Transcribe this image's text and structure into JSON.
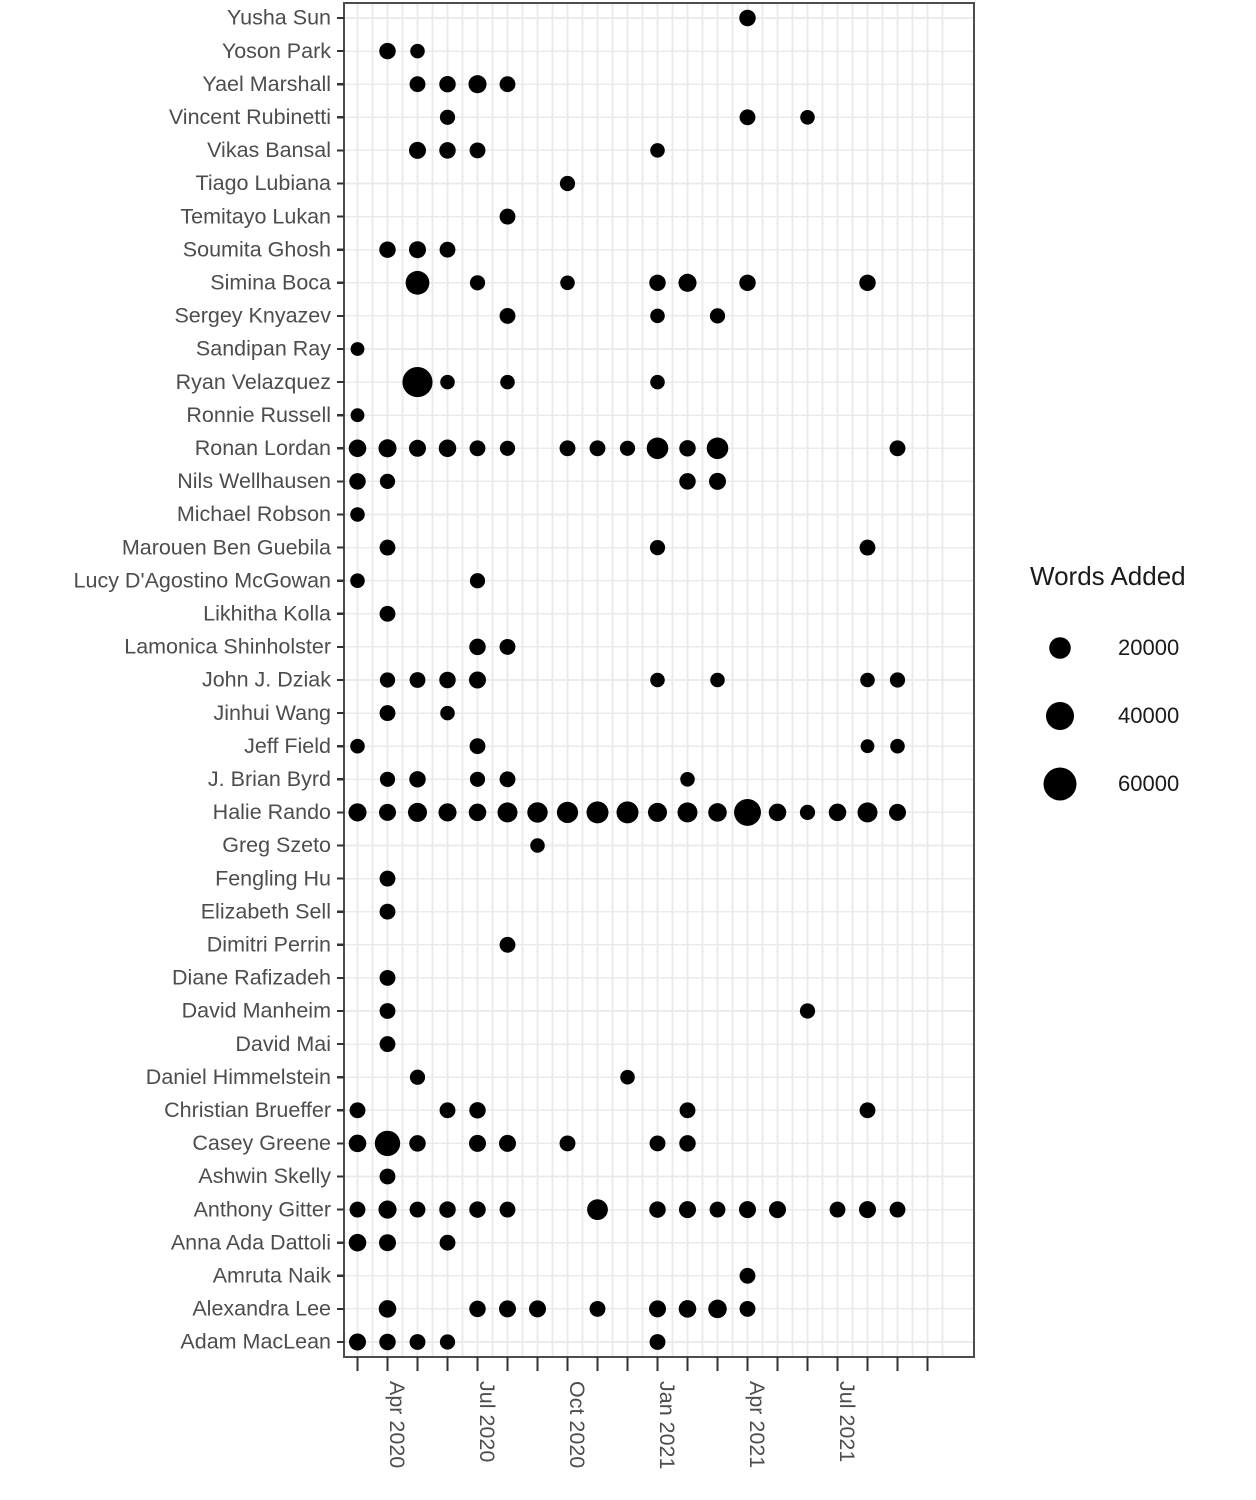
{
  "legend": {
    "title": "Words Added",
    "keys": [
      {
        "label": "20000",
        "value": 20000
      },
      {
        "label": "40000",
        "value": 40000
      },
      {
        "label": "60000",
        "value": 60000
      }
    ]
  },
  "axes": {
    "x_tick_labels": [
      "Apr 2020",
      "Jul 2020",
      "Oct 2020",
      "Jan 2021",
      "Apr 2021",
      "Jul 2021"
    ],
    "x_label": "",
    "y_label": ""
  },
  "chart_data": {
    "type": "scatter",
    "title": "",
    "xlabel": "",
    "ylabel": "",
    "size_legend_title": "Words Added",
    "size_legend_breaks": [
      20000,
      40000,
      60000
    ],
    "grid": true,
    "legend_position": "right",
    "x_axis_type": "date-month",
    "x_months": [
      "2020-03",
      "2020-04",
      "2020-05",
      "2020-06",
      "2020-07",
      "2020-08",
      "2020-09",
      "2020-10",
      "2020-11",
      "2020-12",
      "2021-01",
      "2021-02",
      "2021-03",
      "2021-04",
      "2021-05",
      "2021-06",
      "2021-07",
      "2021-08",
      "2021-09",
      "2021-10"
    ],
    "x_tick_labels": [
      "Apr 2020",
      "Jul 2020",
      "Oct 2020",
      "Jan 2021",
      "Apr 2021",
      "Jul 2021"
    ],
    "x_tick_months": [
      "2020-04",
      "2020-07",
      "2020-10",
      "2021-01",
      "2021-04",
      "2021-07"
    ],
    "categories": [
      "Yusha Sun",
      "Yoson Park",
      "Yael Marshall",
      "Vincent Rubinetti",
      "Vikas Bansal",
      "Tiago Lubiana",
      "Temitayo Lukan",
      "Soumita Ghosh",
      "Simina Boca",
      "Sergey Knyazev",
      "Sandipan Ray",
      "Ryan Velazquez",
      "Ronnie Russell",
      "Ronan Lordan",
      "Nils Wellhausen",
      "Michael Robson",
      "Marouen Ben Guebila",
      "Lucy D'Agostino McGowan",
      "Likhitha Kolla",
      "Lamonica Shinholster",
      "John J. Dziak",
      "Jinhui Wang",
      "Jeff Field",
      "J. Brian Byrd",
      "Halie Rando",
      "Greg Szeto",
      "Fengling Hu",
      "Elizabeth Sell",
      "Dimitri Perrin",
      "Diane Rafizadeh",
      "David Manheim",
      "David Mai",
      "Daniel Himmelstein",
      "Christian Brueffer",
      "Casey Greene",
      "Ashwin Skelly",
      "Anthony Gitter",
      "Anna Ada Dattoli",
      "Amruta Naik",
      "Alexandra Lee",
      "Adam MacLean"
    ],
    "points": [
      {
        "author": "Yusha Sun",
        "month": "2021-04",
        "words": 9000
      },
      {
        "author": "Yoson Park",
        "month": "2020-04",
        "words": 9000
      },
      {
        "author": "Yoson Park",
        "month": "2020-05",
        "words": 6000
      },
      {
        "author": "Yael Marshall",
        "month": "2020-05",
        "words": 8000
      },
      {
        "author": "Yael Marshall",
        "month": "2020-06",
        "words": 9000
      },
      {
        "author": "Yael Marshall",
        "month": "2020-07",
        "words": 12000
      },
      {
        "author": "Yael Marshall",
        "month": "2020-08",
        "words": 8000
      },
      {
        "author": "Vincent Rubinetti",
        "month": "2020-06",
        "words": 7000
      },
      {
        "author": "Vincent Rubinetti",
        "month": "2021-04",
        "words": 8000
      },
      {
        "author": "Vincent Rubinetti",
        "month": "2021-06",
        "words": 6000
      },
      {
        "author": "Vikas Bansal",
        "month": "2020-05",
        "words": 10000
      },
      {
        "author": "Vikas Bansal",
        "month": "2020-06",
        "words": 9000
      },
      {
        "author": "Vikas Bansal",
        "month": "2020-07",
        "words": 8000
      },
      {
        "author": "Vikas Bansal",
        "month": "2021-01",
        "words": 6000
      },
      {
        "author": "Tiago Lubiana",
        "month": "2020-10",
        "words": 7000
      },
      {
        "author": "Temitayo Lukan",
        "month": "2020-08",
        "words": 8000
      },
      {
        "author": "Soumita Ghosh",
        "month": "2020-04",
        "words": 9000
      },
      {
        "author": "Soumita Ghosh",
        "month": "2020-05",
        "words": 10000
      },
      {
        "author": "Soumita Ghosh",
        "month": "2020-06",
        "words": 8000
      },
      {
        "author": "Simina Boca",
        "month": "2020-05",
        "words": 26000
      },
      {
        "author": "Simina Boca",
        "month": "2020-07",
        "words": 7000
      },
      {
        "author": "Simina Boca",
        "month": "2020-10",
        "words": 6000
      },
      {
        "author": "Simina Boca",
        "month": "2021-01",
        "words": 9000
      },
      {
        "author": "Simina Boca",
        "month": "2021-02",
        "words": 12000
      },
      {
        "author": "Simina Boca",
        "month": "2021-04",
        "words": 9000
      },
      {
        "author": "Simina Boca",
        "month": "2021-08",
        "words": 9000
      },
      {
        "author": "Sergey Knyazev",
        "month": "2020-08",
        "words": 8000
      },
      {
        "author": "Sergey Knyazev",
        "month": "2021-01",
        "words": 6000
      },
      {
        "author": "Sergey Knyazev",
        "month": "2021-03",
        "words": 7000
      },
      {
        "author": "Sandipan Ray",
        "month": "2020-03",
        "words": 5000
      },
      {
        "author": "Ryan Velazquez",
        "month": "2020-05",
        "words": 48000
      },
      {
        "author": "Ryan Velazquez",
        "month": "2020-06",
        "words": 6000
      },
      {
        "author": "Ryan Velazquez",
        "month": "2020-08",
        "words": 6000
      },
      {
        "author": "Ryan Velazquez",
        "month": "2021-01",
        "words": 6000
      },
      {
        "author": "Ronnie Russell",
        "month": "2020-03",
        "words": 5000
      },
      {
        "author": "Ronan Lordan",
        "month": "2020-03",
        "words": 11000
      },
      {
        "author": "Ronan Lordan",
        "month": "2020-04",
        "words": 12000
      },
      {
        "author": "Ronan Lordan",
        "month": "2020-05",
        "words": 10000
      },
      {
        "author": "Ronan Lordan",
        "month": "2020-06",
        "words": 11000
      },
      {
        "author": "Ronan Lordan",
        "month": "2020-07",
        "words": 8000
      },
      {
        "author": "Ronan Lordan",
        "month": "2020-08",
        "words": 7000
      },
      {
        "author": "Ronan Lordan",
        "month": "2020-10",
        "words": 8000
      },
      {
        "author": "Ronan Lordan",
        "month": "2020-11",
        "words": 8000
      },
      {
        "author": "Ronan Lordan",
        "month": "2020-12",
        "words": 7000
      },
      {
        "author": "Ronan Lordan",
        "month": "2021-01",
        "words": 20000
      },
      {
        "author": "Ronan Lordan",
        "month": "2021-02",
        "words": 9000
      },
      {
        "author": "Ronan Lordan",
        "month": "2021-03",
        "words": 20000
      },
      {
        "author": "Ronan Lordan",
        "month": "2021-09",
        "words": 8000
      },
      {
        "author": "Nils Wellhausen",
        "month": "2020-03",
        "words": 9000
      },
      {
        "author": "Nils Wellhausen",
        "month": "2020-04",
        "words": 7000
      },
      {
        "author": "Nils Wellhausen",
        "month": "2021-02",
        "words": 9000
      },
      {
        "author": "Nils Wellhausen",
        "month": "2021-03",
        "words": 10000
      },
      {
        "author": "Michael Robson",
        "month": "2020-03",
        "words": 6000
      },
      {
        "author": "Marouen Ben Guebila",
        "month": "2020-04",
        "words": 8000
      },
      {
        "author": "Marouen Ben Guebila",
        "month": "2021-01",
        "words": 7000
      },
      {
        "author": "Marouen Ben Guebila",
        "month": "2021-08",
        "words": 8000
      },
      {
        "author": "Lucy D'Agostino McGowan",
        "month": "2020-03",
        "words": 6000
      },
      {
        "author": "Lucy D'Agostino McGowan",
        "month": "2020-07",
        "words": 7000
      },
      {
        "author": "Likhitha Kolla",
        "month": "2020-04",
        "words": 8000
      },
      {
        "author": "Lamonica Shinholster",
        "month": "2020-07",
        "words": 9000
      },
      {
        "author": "Lamonica Shinholster",
        "month": "2020-08",
        "words": 8000
      },
      {
        "author": "John J. Dziak",
        "month": "2020-04",
        "words": 7000
      },
      {
        "author": "John J. Dziak",
        "month": "2020-05",
        "words": 8000
      },
      {
        "author": "John J. Dziak",
        "month": "2020-06",
        "words": 9000
      },
      {
        "author": "John J. Dziak",
        "month": "2020-07",
        "words": 10000
      },
      {
        "author": "John J. Dziak",
        "month": "2021-01",
        "words": 6000
      },
      {
        "author": "John J. Dziak",
        "month": "2021-03",
        "words": 6000
      },
      {
        "author": "John J. Dziak",
        "month": "2021-08",
        "words": 6000
      },
      {
        "author": "John J. Dziak",
        "month": "2021-09",
        "words": 7000
      },
      {
        "author": "Jinhui Wang",
        "month": "2020-04",
        "words": 8000
      },
      {
        "author": "Jinhui Wang",
        "month": "2020-06",
        "words": 6000
      },
      {
        "author": "Jeff Field",
        "month": "2020-03",
        "words": 6000
      },
      {
        "author": "Jeff Field",
        "month": "2020-07",
        "words": 8000
      },
      {
        "author": "Jeff Field",
        "month": "2021-08",
        "words": 5000
      },
      {
        "author": "Jeff Field",
        "month": "2021-09",
        "words": 6000
      },
      {
        "author": "J. Brian Byrd",
        "month": "2020-04",
        "words": 7000
      },
      {
        "author": "J. Brian Byrd",
        "month": "2020-05",
        "words": 9000
      },
      {
        "author": "J. Brian Byrd",
        "month": "2020-07",
        "words": 7000
      },
      {
        "author": "J. Brian Byrd",
        "month": "2020-08",
        "words": 8000
      },
      {
        "author": "J. Brian Byrd",
        "month": "2021-02",
        "words": 6000
      },
      {
        "author": "Halie Rando",
        "month": "2020-03",
        "words": 12000
      },
      {
        "author": "Halie Rando",
        "month": "2020-04",
        "words": 10000
      },
      {
        "author": "Halie Rando",
        "month": "2020-05",
        "words": 14000
      },
      {
        "author": "Halie Rando",
        "month": "2020-06",
        "words": 12000
      },
      {
        "author": "Halie Rando",
        "month": "2020-07",
        "words": 11000
      },
      {
        "author": "Halie Rando",
        "month": "2020-08",
        "words": 16000
      },
      {
        "author": "Halie Rando",
        "month": "2020-09",
        "words": 17000
      },
      {
        "author": "Halie Rando",
        "month": "2020-10",
        "words": 19000
      },
      {
        "author": "Halie Rando",
        "month": "2020-11",
        "words": 21000
      },
      {
        "author": "Halie Rando",
        "month": "2020-12",
        "words": 21000
      },
      {
        "author": "Halie Rando",
        "month": "2021-01",
        "words": 14000
      },
      {
        "author": "Halie Rando",
        "month": "2021-02",
        "words": 16000
      },
      {
        "author": "Halie Rando",
        "month": "2021-03",
        "words": 13000
      },
      {
        "author": "Halie Rando",
        "month": "2021-04",
        "words": 36000
      },
      {
        "author": "Halie Rando",
        "month": "2021-05",
        "words": 11000
      },
      {
        "author": "Halie Rando",
        "month": "2021-06",
        "words": 7000
      },
      {
        "author": "Halie Rando",
        "month": "2021-07",
        "words": 11000
      },
      {
        "author": "Halie Rando",
        "month": "2021-08",
        "words": 16000
      },
      {
        "author": "Halie Rando",
        "month": "2021-09",
        "words": 10000
      },
      {
        "author": "Greg Szeto",
        "month": "2020-09",
        "words": 6000
      },
      {
        "author": "Fengling Hu",
        "month": "2020-04",
        "words": 8000
      },
      {
        "author": "Elizabeth Sell",
        "month": "2020-04",
        "words": 8000
      },
      {
        "author": "Dimitri Perrin",
        "month": "2020-08",
        "words": 8000
      },
      {
        "author": "Diane Rafizadeh",
        "month": "2020-04",
        "words": 8000
      },
      {
        "author": "David Manheim",
        "month": "2020-04",
        "words": 8000
      },
      {
        "author": "David Manheim",
        "month": "2021-06",
        "words": 7000
      },
      {
        "author": "David Mai",
        "month": "2020-04",
        "words": 8000
      },
      {
        "author": "Daniel Himmelstein",
        "month": "2020-05",
        "words": 7000
      },
      {
        "author": "Daniel Himmelstein",
        "month": "2020-12",
        "words": 6000
      },
      {
        "author": "Christian Brueffer",
        "month": "2020-03",
        "words": 8000
      },
      {
        "author": "Christian Brueffer",
        "month": "2020-06",
        "words": 8000
      },
      {
        "author": "Christian Brueffer",
        "month": "2020-07",
        "words": 9000
      },
      {
        "author": "Christian Brueffer",
        "month": "2021-02",
        "words": 8000
      },
      {
        "author": "Christian Brueffer",
        "month": "2021-08",
        "words": 8000
      },
      {
        "author": "Casey Greene",
        "month": "2020-03",
        "words": 11000
      },
      {
        "author": "Casey Greene",
        "month": "2020-04",
        "words": 31000
      },
      {
        "author": "Casey Greene",
        "month": "2020-05",
        "words": 9000
      },
      {
        "author": "Casey Greene",
        "month": "2020-07",
        "words": 10000
      },
      {
        "author": "Casey Greene",
        "month": "2020-08",
        "words": 10000
      },
      {
        "author": "Casey Greene",
        "month": "2020-10",
        "words": 8000
      },
      {
        "author": "Casey Greene",
        "month": "2021-01",
        "words": 8000
      },
      {
        "author": "Casey Greene",
        "month": "2021-02",
        "words": 9000
      },
      {
        "author": "Ashwin Skelly",
        "month": "2020-04",
        "words": 8000
      },
      {
        "author": "Anthony Gitter",
        "month": "2020-03",
        "words": 8000
      },
      {
        "author": "Anthony Gitter",
        "month": "2020-04",
        "words": 12000
      },
      {
        "author": "Anthony Gitter",
        "month": "2020-05",
        "words": 8000
      },
      {
        "author": "Anthony Gitter",
        "month": "2020-06",
        "words": 9000
      },
      {
        "author": "Anthony Gitter",
        "month": "2020-07",
        "words": 9000
      },
      {
        "author": "Anthony Gitter",
        "month": "2020-08",
        "words": 8000
      },
      {
        "author": "Anthony Gitter",
        "month": "2020-11",
        "words": 18000
      },
      {
        "author": "Anthony Gitter",
        "month": "2021-01",
        "words": 9000
      },
      {
        "author": "Anthony Gitter",
        "month": "2021-02",
        "words": 10000
      },
      {
        "author": "Anthony Gitter",
        "month": "2021-03",
        "words": 8000
      },
      {
        "author": "Anthony Gitter",
        "month": "2021-04",
        "words": 10000
      },
      {
        "author": "Anthony Gitter",
        "month": "2021-05",
        "words": 10000
      },
      {
        "author": "Anthony Gitter",
        "month": "2021-07",
        "words": 8000
      },
      {
        "author": "Anthony Gitter",
        "month": "2021-08",
        "words": 10000
      },
      {
        "author": "Anthony Gitter",
        "month": "2021-09",
        "words": 8000
      },
      {
        "author": "Anna Ada Dattoli",
        "month": "2020-03",
        "words": 11000
      },
      {
        "author": "Anna Ada Dattoli",
        "month": "2020-04",
        "words": 10000
      },
      {
        "author": "Anna Ada Dattoli",
        "month": "2020-06",
        "words": 8000
      },
      {
        "author": "Amruta Naik",
        "month": "2021-04",
        "words": 8000
      },
      {
        "author": "Alexandra Lee",
        "month": "2020-04",
        "words": 11000
      },
      {
        "author": "Alexandra Lee",
        "month": "2020-07",
        "words": 9000
      },
      {
        "author": "Alexandra Lee",
        "month": "2020-08",
        "words": 10000
      },
      {
        "author": "Alexandra Lee",
        "month": "2020-09",
        "words": 10000
      },
      {
        "author": "Alexandra Lee",
        "month": "2020-11",
        "words": 8000
      },
      {
        "author": "Alexandra Lee",
        "month": "2021-01",
        "words": 10000
      },
      {
        "author": "Alexandra Lee",
        "month": "2021-02",
        "words": 11000
      },
      {
        "author": "Alexandra Lee",
        "month": "2021-03",
        "words": 13000
      },
      {
        "author": "Alexandra Lee",
        "month": "2021-04",
        "words": 8000
      },
      {
        "author": "Adam MacLean",
        "month": "2020-03",
        "words": 10000
      },
      {
        "author": "Adam MacLean",
        "month": "2020-04",
        "words": 9000
      },
      {
        "author": "Adam MacLean",
        "month": "2020-05",
        "words": 8000
      },
      {
        "author": "Adam MacLean",
        "month": "2020-06",
        "words": 7000
      },
      {
        "author": "Adam MacLean",
        "month": "2021-01",
        "words": 8000
      }
    ]
  }
}
